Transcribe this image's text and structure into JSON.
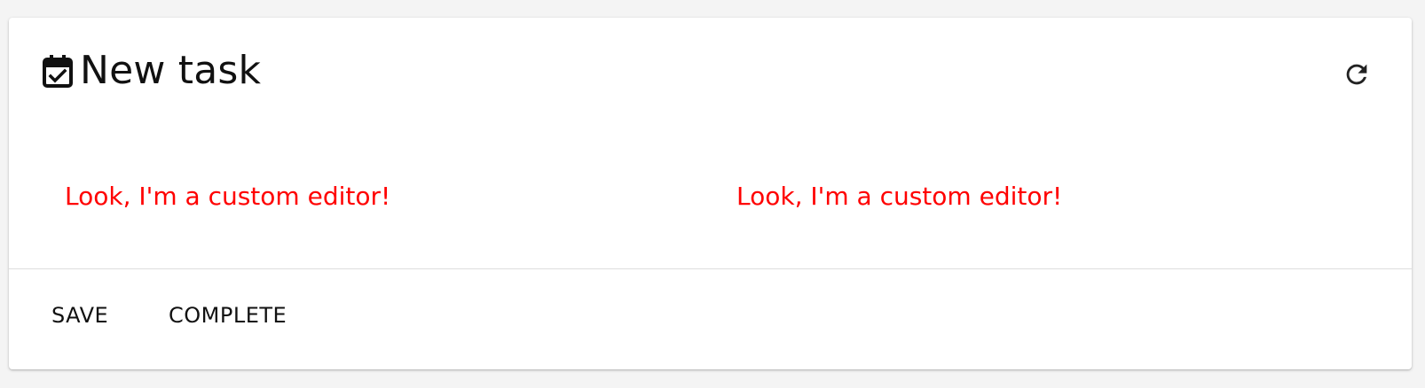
{
  "header": {
    "title": "New task",
    "title_icon": "calendar-check-icon",
    "refresh_icon": "refresh-icon"
  },
  "editors": [
    {
      "text": "Look, I'm a custom editor!"
    },
    {
      "text": "Look, I'm a custom editor!"
    }
  ],
  "actions": {
    "save_label": "SAVE",
    "complete_label": "COMPLETE"
  },
  "colors": {
    "editor_text": "#ff0000",
    "background": "#f4f4f4",
    "card": "#ffffff"
  }
}
